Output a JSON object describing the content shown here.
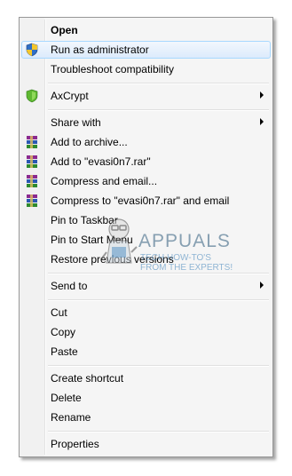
{
  "menu": {
    "items": [
      {
        "label": "Open",
        "bold": true
      },
      {
        "label": "Run as administrator",
        "icon": "uac-shield-icon",
        "highlighted": true
      },
      {
        "label": "Troubleshoot compatibility"
      },
      {
        "label": "AxCrypt",
        "icon": "axcrypt-shield-icon",
        "submenu": true
      },
      {
        "label": "Share with",
        "submenu": true
      },
      {
        "label": "Add to archive...",
        "icon": "winrar-icon"
      },
      {
        "label": "Add to \"evasi0n7.rar\"",
        "icon": "winrar-icon"
      },
      {
        "label": "Compress and email...",
        "icon": "winrar-icon"
      },
      {
        "label": "Compress to \"evasi0n7.rar\" and email",
        "icon": "winrar-icon"
      },
      {
        "label": "Pin to Taskbar"
      },
      {
        "label": "Pin to Start Menu"
      },
      {
        "label": "Restore previous versions"
      },
      {
        "label": "Send to",
        "submenu": true
      },
      {
        "label": "Cut"
      },
      {
        "label": "Copy"
      },
      {
        "label": "Paste"
      },
      {
        "label": "Create shortcut"
      },
      {
        "label": "Delete"
      },
      {
        "label": "Rename"
      },
      {
        "label": "Properties"
      }
    ]
  },
  "watermark": {
    "title": "APPUALS",
    "subtitle": "TECH HOW-TO'S FROM THE EXPERTS!"
  },
  "colors": {
    "menu_bg": "#f5f5f5",
    "hover_border": "#a8d8ff",
    "hover_bg": "#dcebfc"
  }
}
